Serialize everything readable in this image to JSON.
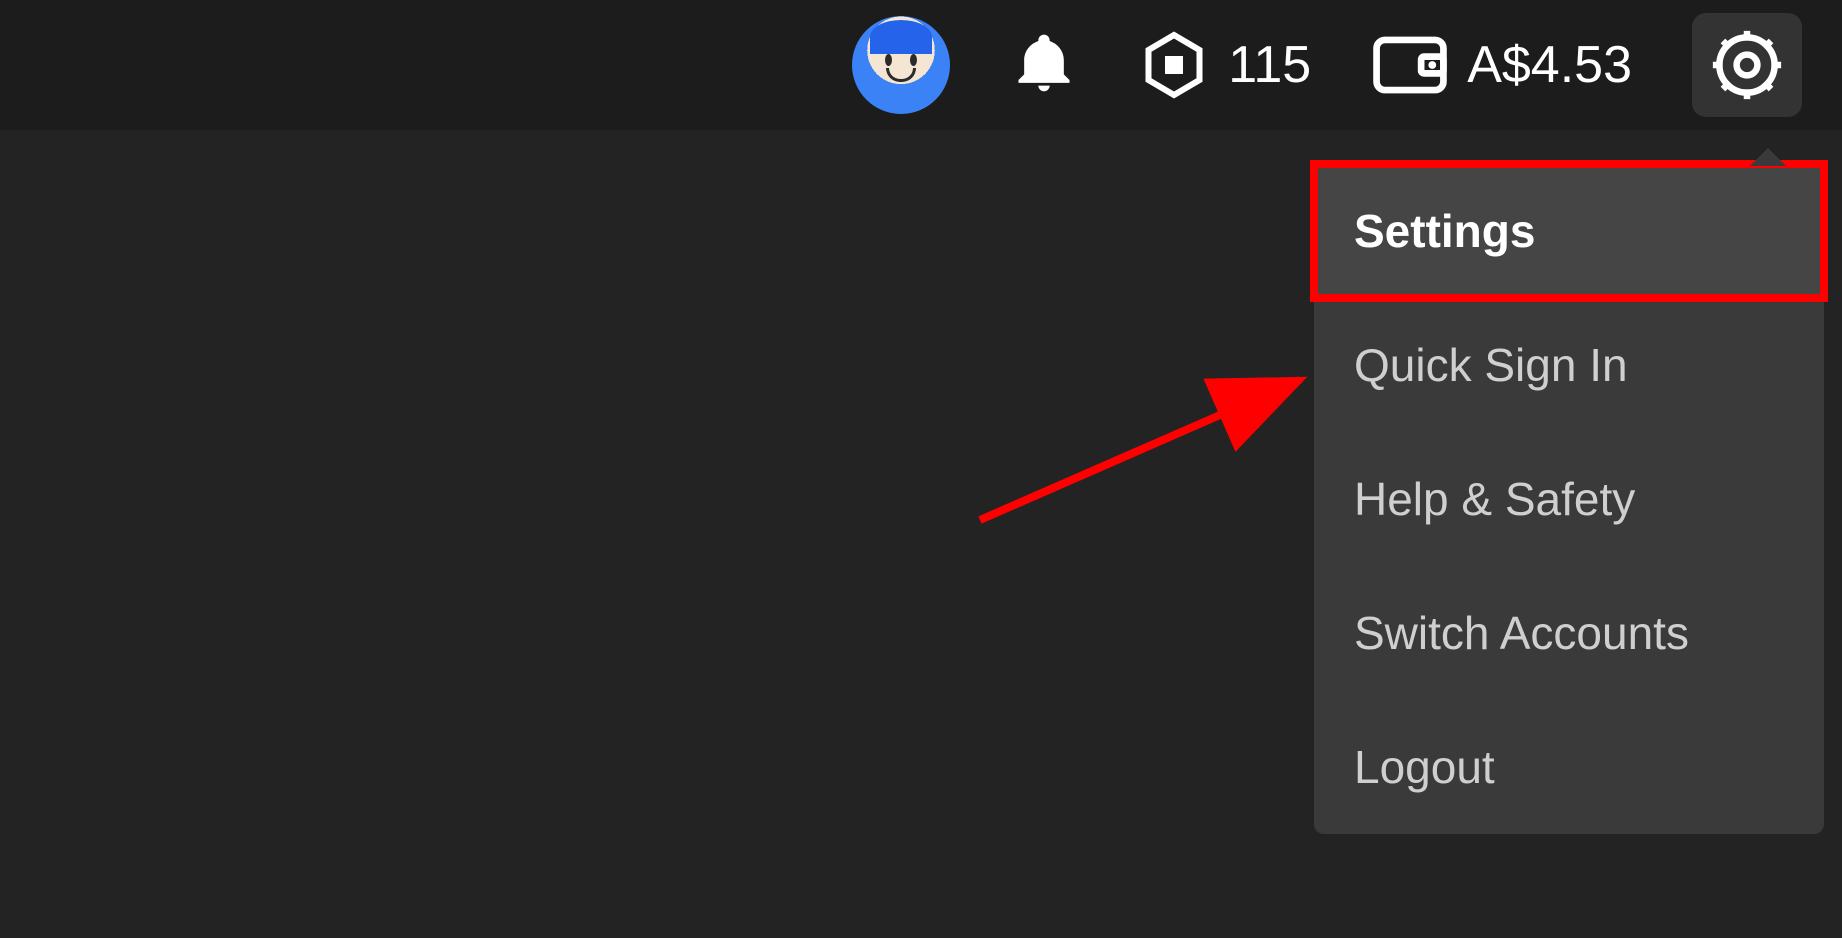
{
  "topbar": {
    "robux_count": "115",
    "wallet_balance": "A$4.53"
  },
  "menu": {
    "items": [
      {
        "label": "Settings",
        "highlighted": true
      },
      {
        "label": "Quick Sign In",
        "highlighted": false
      },
      {
        "label": "Help & Safety",
        "highlighted": false
      },
      {
        "label": "Switch Accounts",
        "highlighted": false
      },
      {
        "label": "Logout",
        "highlighted": false
      }
    ]
  }
}
